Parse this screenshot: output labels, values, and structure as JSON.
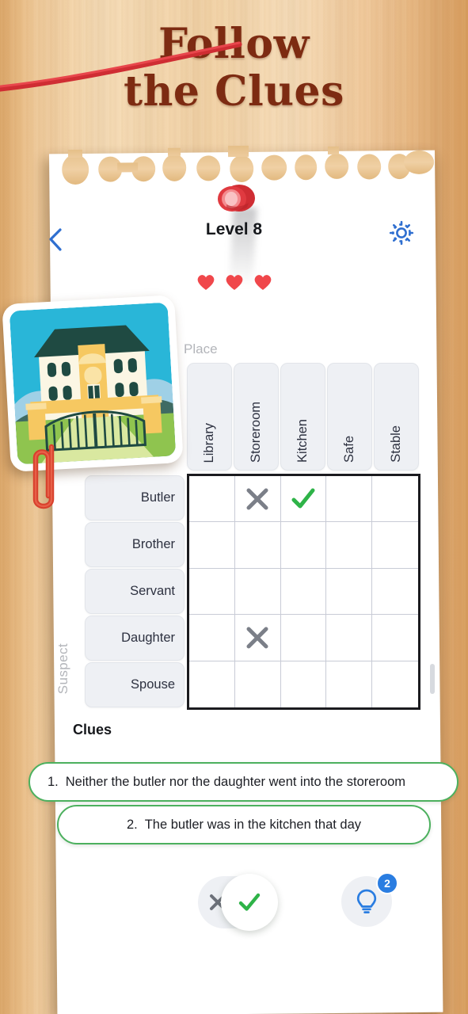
{
  "promo": {
    "title_line1": "Follow",
    "title_line2": "the Clues",
    "title_color": "#7d2b12"
  },
  "header": {
    "back_label": "",
    "level_title": "Level 8",
    "settings_label": "",
    "lives": 3,
    "accent_blue": "#3b7edc"
  },
  "board": {
    "column_axis_label": "Place",
    "row_axis_label": "Suspect",
    "columns": [
      "Library",
      "Storeroom",
      "Kitchen",
      "Safe",
      "Stable"
    ],
    "rows": [
      "Butler",
      "Brother",
      "Servant",
      "Daughter",
      "Spouse"
    ],
    "cells": [
      [
        "",
        "x",
        "check",
        "",
        ""
      ],
      [
        "",
        "",
        "",
        "",
        ""
      ],
      [
        "",
        "",
        "",
        "",
        ""
      ],
      [
        "",
        "x",
        "",
        "",
        ""
      ],
      [
        "",
        "",
        "",
        "",
        ""
      ]
    ],
    "mark_x_color": "#7b7f88",
    "mark_check_color": "#2eb348"
  },
  "clues": {
    "heading": "Clues",
    "items": [
      {
        "num": "1.",
        "text": "Neither the butler nor the daughter went into the storeroom"
      },
      {
        "num": "2.",
        "text": "The butler was in the kitchen that day"
      }
    ],
    "border_color": "#4cb05e"
  },
  "toolbar": {
    "mark_mode_x": "x",
    "mark_mode_check": "check",
    "selected_mode": "check",
    "hint_label": "hint-bulb",
    "hint_count": "2",
    "badge_color": "#2a7de1"
  },
  "decor": {
    "photo_caption": "mansion-illustration",
    "paperclip": "red-paperclip",
    "pushpin": "red-pushpin",
    "cord": "red-cord"
  }
}
